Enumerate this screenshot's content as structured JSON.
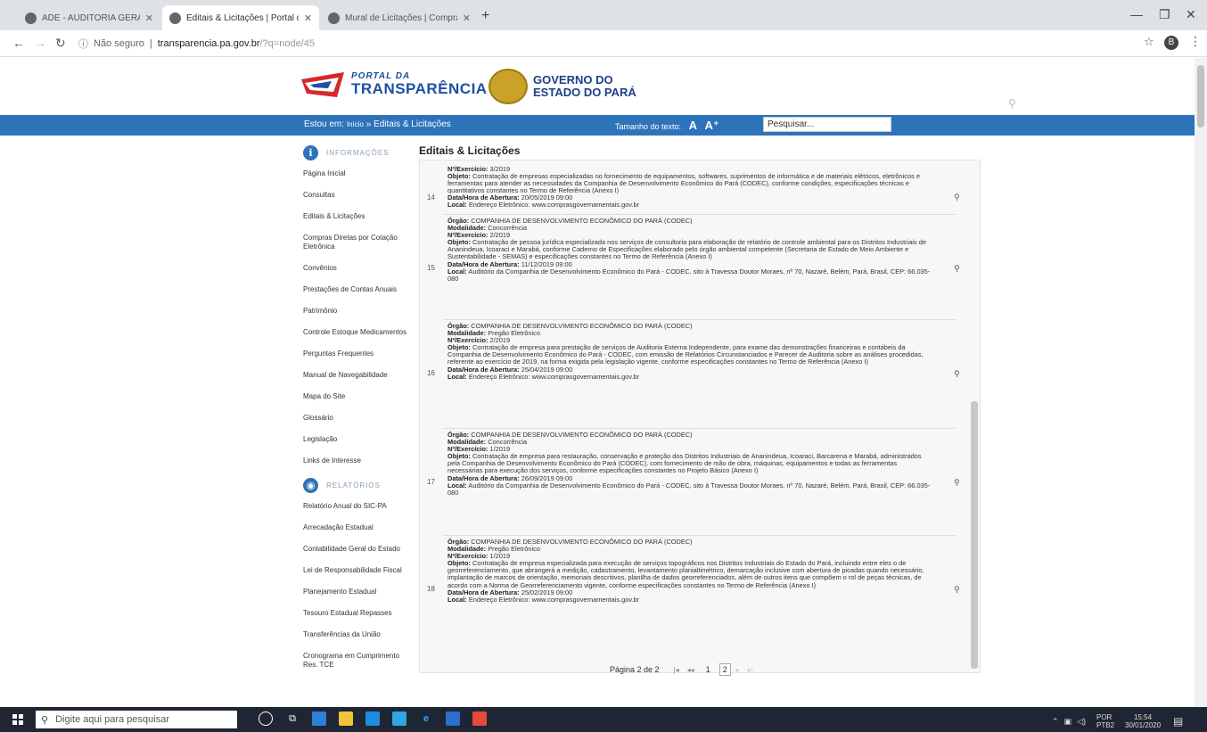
{
  "browser": {
    "tabs": [
      {
        "title": "ADE - AUDITORIA GERAL DO ES"
      },
      {
        "title": "Editais & Licitações | Portal da T"
      },
      {
        "title": "Mural de Licitações | Compras P"
      }
    ],
    "url": {
      "security": "Não seguro",
      "host": "transparencia.pa.gov.br",
      "path": "/?q=node/45"
    },
    "profile_initial": "B"
  },
  "header": {
    "portal_small": "PORTAL DA",
    "portal_big": "TRANSPARÊNCIA",
    "gov_line1": "GOVERNO DO",
    "gov_line2": "ESTADO DO PARÁ"
  },
  "bar": {
    "estou_em": "Estou em:",
    "crumb_home": "Início",
    "crumb_sep": "»",
    "crumb_current": "Editais & Licitações",
    "font_size_label": "Tamanho do texto:",
    "font_small": "A",
    "font_big": "A⁺",
    "search_value": "Pesquisar..."
  },
  "sidebar": {
    "info_label": "INFORMAÇÕES",
    "items": [
      "Página Inicial",
      "Consultas",
      "Editais & Licitações",
      "Compras Diretas por Cotação Eletrônica",
      "Convênios",
      "Prestações de Contas Anuais",
      "Patrimônio",
      "Controle Estoque Medicamentos",
      "Perguntas Frequentes",
      "Manual de Navegabilidade",
      "Mapa do Site",
      "Glossário",
      "Legislação",
      "Links de Interesse"
    ],
    "rel_label": "RELATÓRIOS",
    "rel_items": [
      "Relatório Anual do SIC-PA",
      "Arrecadação Estadual",
      "Contabilidade Geral do Estado",
      "Lei de Responsabilidade Fiscal",
      "Planejamento Estadual",
      "Tesouro Estadual Repasses",
      "Transferências da União",
      "Cronograma em Cumprimento Res. TCE"
    ]
  },
  "main": {
    "title": "Editais & Licitações",
    "labels": {
      "orgao": "Órgão:",
      "modalidade": "Modalidade:",
      "exercicio": "Nº/Exercício:",
      "objeto": "Objeto:",
      "abertura": "Data/Hora de Abertura:",
      "local": "Local:"
    },
    "entries": [
      {
        "num": "14",
        "exercicio": "3/2019",
        "objeto": "Contratação de empresas especializadas no fornecimento de equipamentos, softwares, suprimentos de informática e de materiais elétricos, eletrônicos e ferramentas para atender as necessidades da Companhia de Desenvolvimento Econômico do Pará (CODEC), conforme condições, especificações técnicas e quantitativos constantes no Termo de Referência (Anexo I)",
        "abertura": "20/05/2019 09:00",
        "local": "Endereço Eletrônico: www.comprasgovernamentais.gov.br"
      },
      {
        "num": "15",
        "orgao": "COMPANHIA DE DESENVOLVIMENTO ECONÔMICO DO PARÁ (CODEC)",
        "modalidade": "Concorrência",
        "exercicio": "2/2019",
        "objeto": "Contratação de pessoa jurídica especializada nos serviços de consultoria para elaboração de relatório de controle ambiental para os Distritos Industriais de Ananindeua, Icoaraci e Marabá, conforme Caderno de Especificações elaborado pelo órgão ambiental competente (Secretaria de Estado de Meio Ambiente e Sustentabilidade - SEMAS) e especificações constantes no Termo de Referência (Anexo I)",
        "abertura": "11/12/2019 09:00",
        "local": "Auditório da Companhia de Desenvolvimento Econômico do Pará - CODEC, sito à Travessa Doutor Moraes, nº 70, Nazaré, Belém, Pará, Brasil, CEP: 66.035-080"
      },
      {
        "num": "16",
        "orgao": "COMPANHIA DE DESENVOLVIMENTO ECONÔMICO DO PARÁ (CODEC)",
        "modalidade": "Pregão Eletrônico",
        "exercicio": "2/2019",
        "objeto": "Contratação de empresa para prestação de serviços de Auditoria Externa Independente, para exame das demonstrações financeiras e contábeis da Companhia de Desenvolvimento Econômico do Pará - CODEC, com emissão de Relatórios Circunstanciados e Parecer de Auditoria sobre as análises procedidas, referente ao exercício de 2019, na forma exigida pela legislação vigente, conforme especificações constantes no Termo de Referência (Anexo I)",
        "abertura": "25/04/2019 09:00",
        "local": "Endereço Eletrônico: www.comprasgovernamentais.gov.br"
      },
      {
        "num": "17",
        "orgao": "COMPANHIA DE DESENVOLVIMENTO ECONÔMICO DO PARÁ (CODEC)",
        "modalidade": "Concorrência",
        "exercicio": "1/2019",
        "objeto": "Contratação de empresa para restauração, conservação e proteção dos Distritos Industriais de Ananindeua, Icoaraci, Barcarena e Marabá, administrados pela Companhia de Desenvolvimento Econômico do Pará (CODEC), com fornecimento de mão de obra, máquinas, equipamentos e todas as ferramentas necessárias para execução dos serviços, conforme especificações constantes no Projeto Básico (Anexo I)",
        "abertura": "26/09/2019 09:00",
        "local": "Auditório da Companhia de Desenvolvimento Econômico do Pará - CODEC, sito à Travessa Doutor Moraes, nº 70, Nazaré, Belém, Pará, Brasil, CEP: 66.035-080"
      },
      {
        "num": "18",
        "orgao": "COMPANHIA DE DESENVOLVIMENTO ECONÔMICO DO PARÁ (CODEC)",
        "modalidade": "Pregão Eletrônico",
        "exercicio": "1/2019",
        "objeto": "Contratação de empresa especializada para execução de serviços topográficos nos Distritos Industriais do Estado do Pará, incluindo entre eles o de georreferenciamento, que abrangerá a medição, cadastramento, levantamento planialtimétrico, demarcação inclusive com abertura de picadas quando necessário, implantação de marcos de orientação, memoriais descritivos, planilha de dados georreferenciados, além de outros itens que compõem o rol de peças técnicas, de acordo com a Norma de Georreferenciamento vigente, conforme especificações constantes no Termo de Referência (Anexo I)",
        "abertura": "25/02/2019 09:00",
        "local": "Endereço Eletrônico: www.comprasgovernamentais.gov.br"
      }
    ],
    "pager": {
      "label": "Página 2 de 2",
      "first": "|◂",
      "prev": "◂◂",
      "p1": "1",
      "p2": "2",
      "next": "▸",
      "last": "▸|"
    }
  },
  "taskbar": {
    "search_placeholder": "Digite aqui para pesquisar",
    "lang1": "POR",
    "lang2": "PTB2",
    "time": "15:54",
    "date": "30/01/2020"
  }
}
